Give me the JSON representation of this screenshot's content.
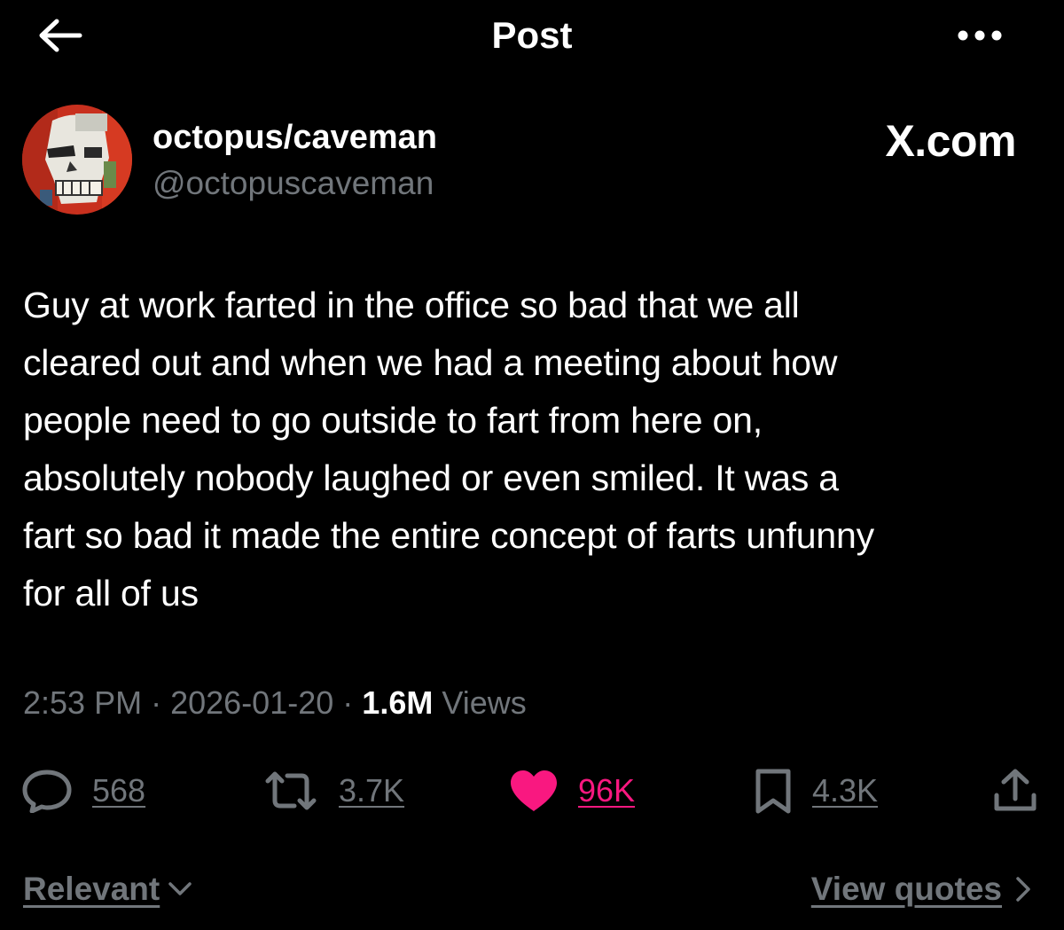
{
  "header": {
    "title": "Post",
    "back_icon": "arrow-left-icon",
    "more_icon": "more-horizontal-icon"
  },
  "author": {
    "display_name": "octopus/caveman",
    "handle": "@octopuscaveman",
    "avatar_icon": "avatar-skull-painting"
  },
  "watermark": "X.com",
  "post": {
    "text": "Guy at work farted in the office so bad that we all\ncleared out and when we had a meeting about how\npeople need to go outside to fart from here on,\nabsolutely nobody laughed or even smiled. It was a\nfart so bad it made the entire concept of farts unfunny\nfor all of us",
    "time": "2:53 PM",
    "date": "2026-01-20",
    "views_count": "1.6M",
    "views_label": "Views",
    "separator": "·"
  },
  "actions": {
    "replies": {
      "count": "568",
      "icon": "reply-icon"
    },
    "reposts": {
      "count": "3.7K",
      "icon": "repost-icon"
    },
    "likes": {
      "count": "96K",
      "icon": "heart-filled-icon",
      "color": "#f91880"
    },
    "bookmarks": {
      "count": "4.3K",
      "icon": "bookmark-icon"
    },
    "share": {
      "icon": "share-icon"
    }
  },
  "footer": {
    "sort_label": "Relevant",
    "quotes_label": "View quotes"
  },
  "colors": {
    "background": "#000000",
    "text": "#ffffff",
    "muted": "#71767b",
    "like": "#f91880"
  }
}
